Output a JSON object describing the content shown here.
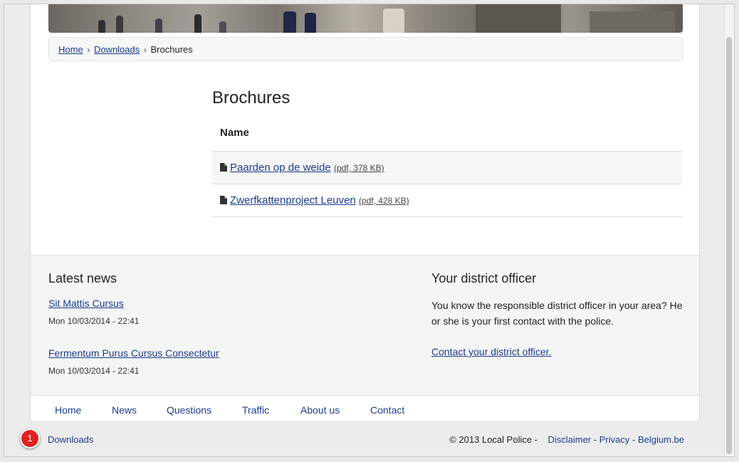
{
  "breadcrumb": {
    "home": "Home",
    "sep1": "›",
    "downloads": "Downloads",
    "sep2": "›",
    "current": "Brochures"
  },
  "page_title": "Brochures",
  "table": {
    "header": "Name",
    "rows": [
      {
        "name": "Paarden op de weide",
        "meta": "(pdf, 378 KB)"
      },
      {
        "name": "Zwerfkattenproject Leuven",
        "meta": "(pdf, 428 KB)"
      }
    ]
  },
  "news": {
    "title": "Latest news",
    "items": [
      {
        "title": "Sit Mattis Cursus",
        "date": "Mon 10/03/2014 - 22:41"
      },
      {
        "title": "Fermentum Purus Cursus Consectetur",
        "date": "Mon 10/03/2014 - 22:41"
      }
    ]
  },
  "officer": {
    "title": "Your district officer",
    "text": "You know the responsible district officer in your area? He or she is your first contact with the police.",
    "link": "Contact your district officer."
  },
  "nav": {
    "items": [
      "Home",
      "News",
      "Questions",
      "Traffic",
      "About us",
      "Contact"
    ]
  },
  "bottom": {
    "downloads": "Downloads",
    "badge": "1",
    "copyright": "© 2013 Local Police -",
    "disclaimer": "Disclaimer",
    "privacy": "Privacy",
    "belgium": "Belgium.be",
    "dash": "-"
  },
  "colors": {
    "link": "#1a3d8f",
    "badge": "#e02020",
    "footer_bg": "#f5f5f5"
  },
  "icons": {
    "file": "file-icon"
  }
}
